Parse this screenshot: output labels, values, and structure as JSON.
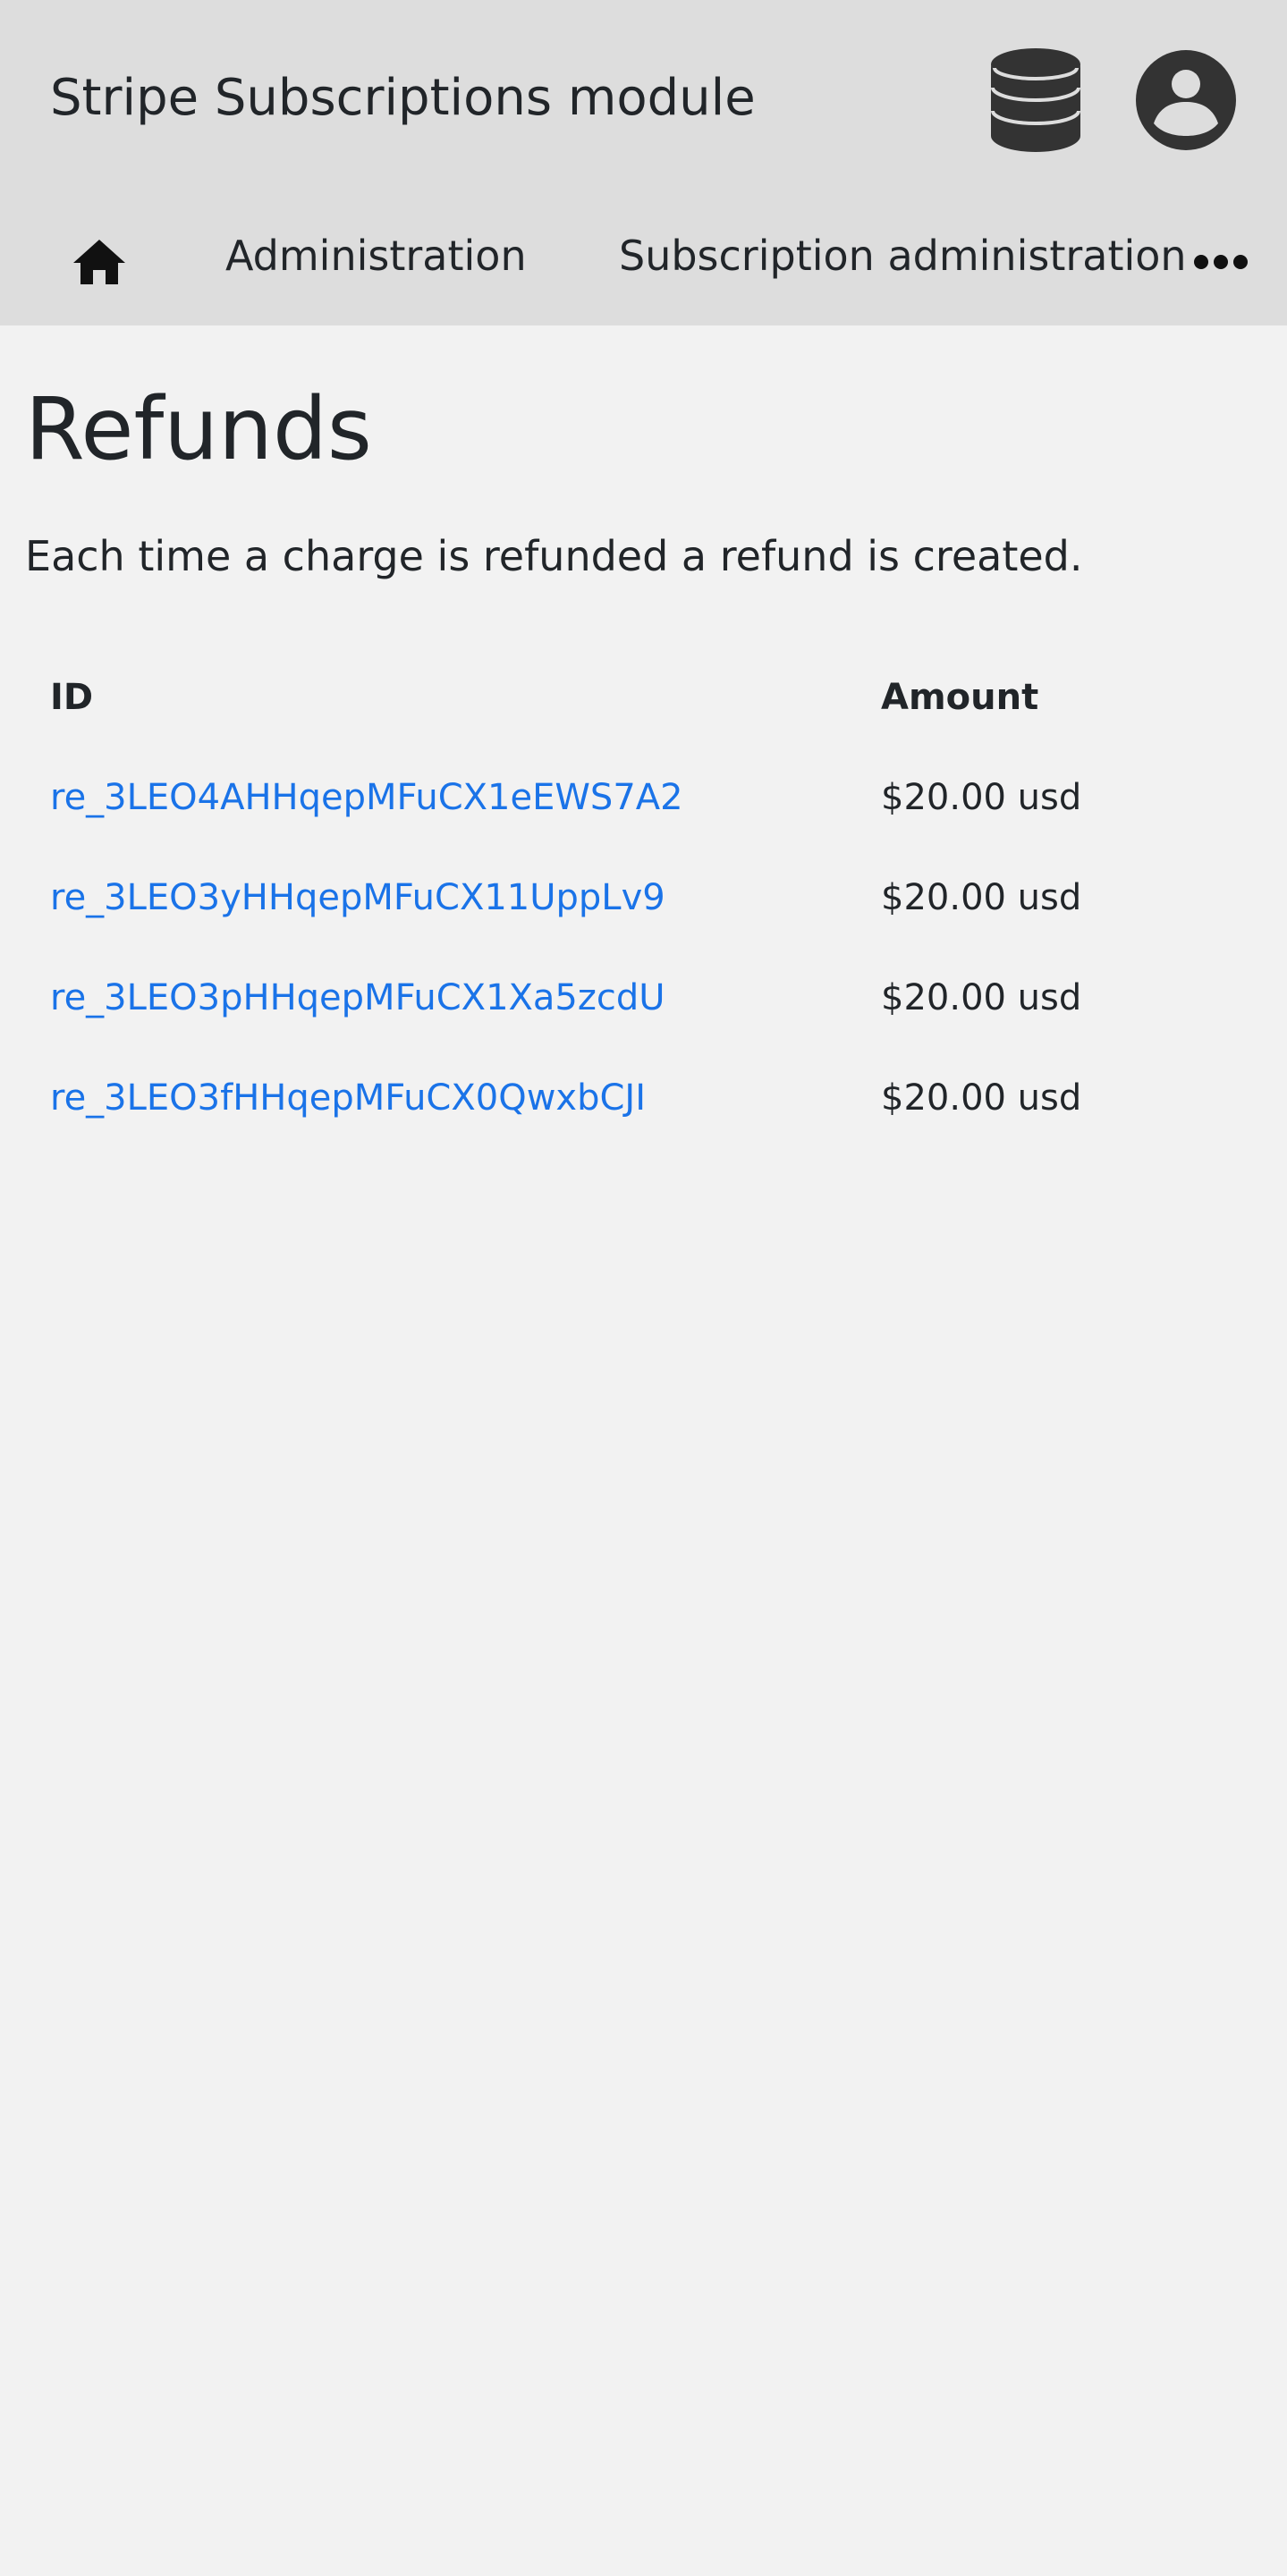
{
  "header": {
    "app_title": "Stripe Subscriptions module"
  },
  "nav": {
    "home_icon": "home-icon",
    "items": [
      {
        "label": "Administration"
      },
      {
        "label": "Subscription administration"
      }
    ],
    "more_icon": "more-horizontal-icon"
  },
  "page": {
    "title": "Refunds",
    "description": "Each time a charge is refunded a refund is created."
  },
  "table": {
    "columns": [
      "ID",
      "Amount"
    ],
    "rows": [
      {
        "id": "re_3LEO4AHHqepMFuCX1eEWS7A2",
        "amount": "$20.00 usd"
      },
      {
        "id": "re_3LEO3yHHqepMFuCX11UppLv9",
        "amount": "$20.00 usd"
      },
      {
        "id": "re_3LEO3pHHqepMFuCX1Xa5zcdU",
        "amount": "$20.00 usd"
      },
      {
        "id": "re_3LEO3fHHqepMFuCX0QwxbCJI",
        "amount": "$20.00 usd"
      }
    ]
  },
  "colors": {
    "header_bg": "#dddddd",
    "page_bg": "#f2f2f2",
    "link": "#1a73e8",
    "text": "#212529",
    "icon": "#333333"
  }
}
